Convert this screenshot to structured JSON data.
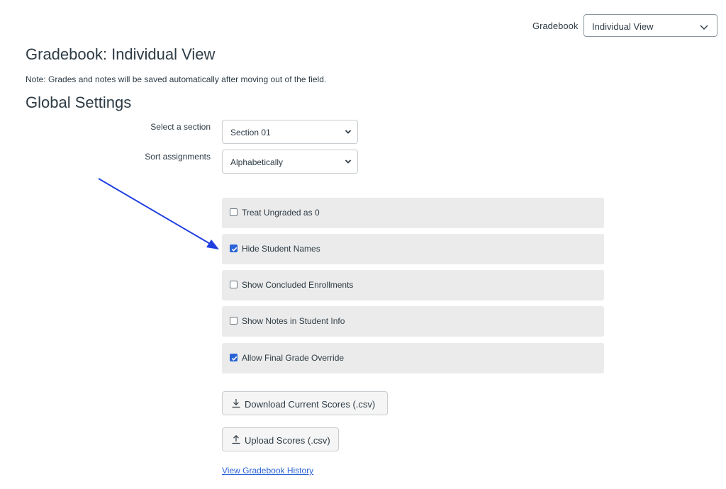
{
  "header": {
    "gradebook_label": "Gradebook",
    "view_select_value": "Individual View"
  },
  "page": {
    "title": "Gradebook: Individual View",
    "note": "Note: Grades and notes will be saved automatically after moving out of the field."
  },
  "global_settings": {
    "title": "Global Settings",
    "section_label": "Select a section",
    "section_value": "Section 01",
    "sort_label": "Sort assignments",
    "sort_value": "Alphabetically",
    "options": [
      {
        "label": "Treat Ungraded as 0",
        "checked": false
      },
      {
        "label": "Hide Student Names",
        "checked": true
      },
      {
        "label": "Show Concluded Enrollments",
        "checked": false
      },
      {
        "label": "Show Notes in Student Info",
        "checked": false
      },
      {
        "label": "Allow Final Grade Override",
        "checked": true
      }
    ],
    "download_button": "Download Current Scores (.csv)",
    "upload_button": "Upload Scores (.csv)",
    "history_link": "View Gradebook History"
  },
  "colors": {
    "accent": "#2a63d6",
    "text": "#2d3b45",
    "row_bg": "#ebebeb",
    "annotation_arrow": "#1f3fe0"
  },
  "icons": {
    "view_select_chevron": "chevron-down-icon",
    "download": "download-icon",
    "upload": "upload-icon"
  }
}
